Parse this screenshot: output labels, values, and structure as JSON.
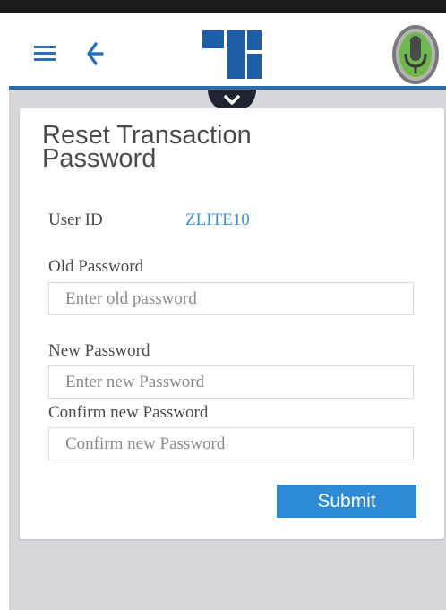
{
  "header": {
    "menu_icon": "hamburger-menu-icon",
    "back_icon": "back-arrow-icon",
    "logo_icon": "bank-logo",
    "voice_icon": "microphone-icon",
    "accent_color": "#2c6fb0"
  },
  "form": {
    "title": "Reset Transaction Password",
    "user_id_label": "User ID",
    "user_id_value": "ZLITE10",
    "old_password_label": "Old Password",
    "old_password_placeholder": "Enter old password",
    "new_password_label": "New Password",
    "new_password_placeholder": "Enter new Password",
    "confirm_password_label": "Confirm new Password",
    "confirm_password_placeholder": "Confirm new Password",
    "submit_label": "Submit",
    "submit_color": "#2d8ad4"
  }
}
